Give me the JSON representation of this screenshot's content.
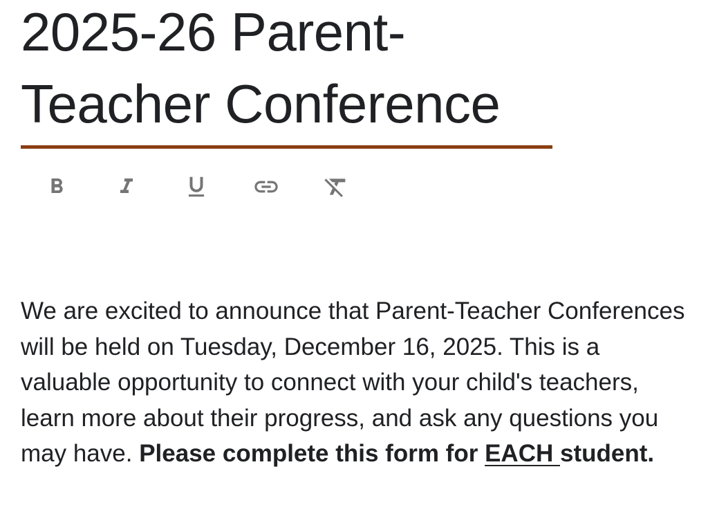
{
  "form": {
    "title": "2025-26 Parent-Teacher Conference",
    "accent_color": "#8b3f12",
    "description": {
      "plain": "We are excited to announce that Parent-Teacher Conferences will be held on Tuesday, December 16, 2025. This is a valuable opportunity to connect with your child's teachers, learn more about their progress, and ask any questions you may have. ",
      "bold_lead": "Please complete this form for ",
      "bold_underlined": "EACH ",
      "bold_tail": "student."
    }
  },
  "toolbar": {
    "buttons": [
      {
        "icon": "bold-icon"
      },
      {
        "icon": "italic-icon"
      },
      {
        "icon": "underline-icon"
      },
      {
        "icon": "link-icon"
      },
      {
        "icon": "clear-formatting-icon"
      }
    ],
    "icon_color": "#757575"
  }
}
